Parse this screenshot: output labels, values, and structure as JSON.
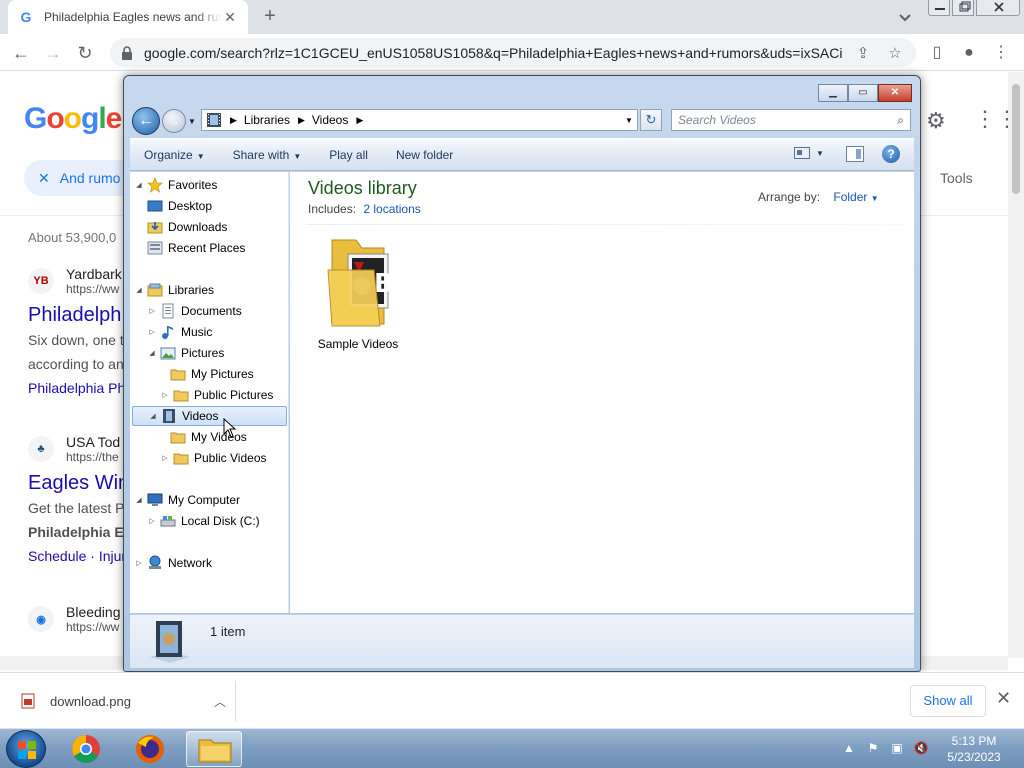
{
  "browser": {
    "tab_title": "Philadelphia Eagles news and rumors",
    "tab_favicon": "G",
    "new_tab_symbol": "+",
    "url": "google.com/search?rlz=1C1GCEU_enUS1058US1058&q=Philadelphia+Eagles+news+and+rumors&uds=ixSACig..."
  },
  "google": {
    "logo": [
      "G",
      "o",
      "o",
      "g",
      "l",
      "e"
    ],
    "logo_colors": [
      "#4285f4",
      "#ea4335",
      "#fbbc05",
      "#4285f4",
      "#34a853",
      "#ea4335"
    ],
    "chip_label": "And rumo",
    "tools_label": "Tools",
    "result_stats": "About 53,900,0",
    "results": [
      {
        "icon_text": "YB",
        "site": "Yardbark",
        "url": "https://ww",
        "title": "Philadelph",
        "snippet": [
          "Six down, one t",
          "according to an",
          "Philadelphia Ph"
        ]
      },
      {
        "icon_text": "♣",
        "site": "USA Tod",
        "url": "https://the",
        "title": "Eagles Win",
        "snippet": [
          "Get the latest P",
          "Philadelphia Ea",
          "Schedule · Injur"
        ]
      },
      {
        "icon_text": "◉",
        "site": "Bleeding",
        "url": "https://ww",
        "title": "",
        "snippet": []
      }
    ]
  },
  "explorer": {
    "breadcrumb": [
      "Libraries",
      "Videos"
    ],
    "search_placeholder": "Search Videos",
    "commands": {
      "organize": "Organize",
      "share_with": "Share with",
      "play_all": "Play all",
      "new_folder": "New folder"
    },
    "nav": {
      "favorites": "Favorites",
      "desktop": "Desktop",
      "downloads": "Downloads",
      "recent_places": "Recent Places",
      "libraries": "Libraries",
      "documents": "Documents",
      "music": "Music",
      "pictures": "Pictures",
      "my_pictures": "My Pictures",
      "public_pictures": "Public Pictures",
      "videos": "Videos",
      "my_videos": "My Videos",
      "public_videos": "Public Videos",
      "my_computer": "My Computer",
      "local_disk": "Local Disk (C:)",
      "network": "Network"
    },
    "library_title": "Videos library",
    "includes_label": "Includes:",
    "includes_link": "2 locations",
    "arrange_label": "Arrange by:",
    "arrange_value": "Folder",
    "items": [
      {
        "name": "Sample Videos"
      }
    ],
    "item_count": "1 item"
  },
  "downloads": {
    "file_name": "download.png",
    "show_all": "Show all"
  },
  "taskbar": {
    "time": "5:13 PM",
    "date": "5/23/2023"
  }
}
